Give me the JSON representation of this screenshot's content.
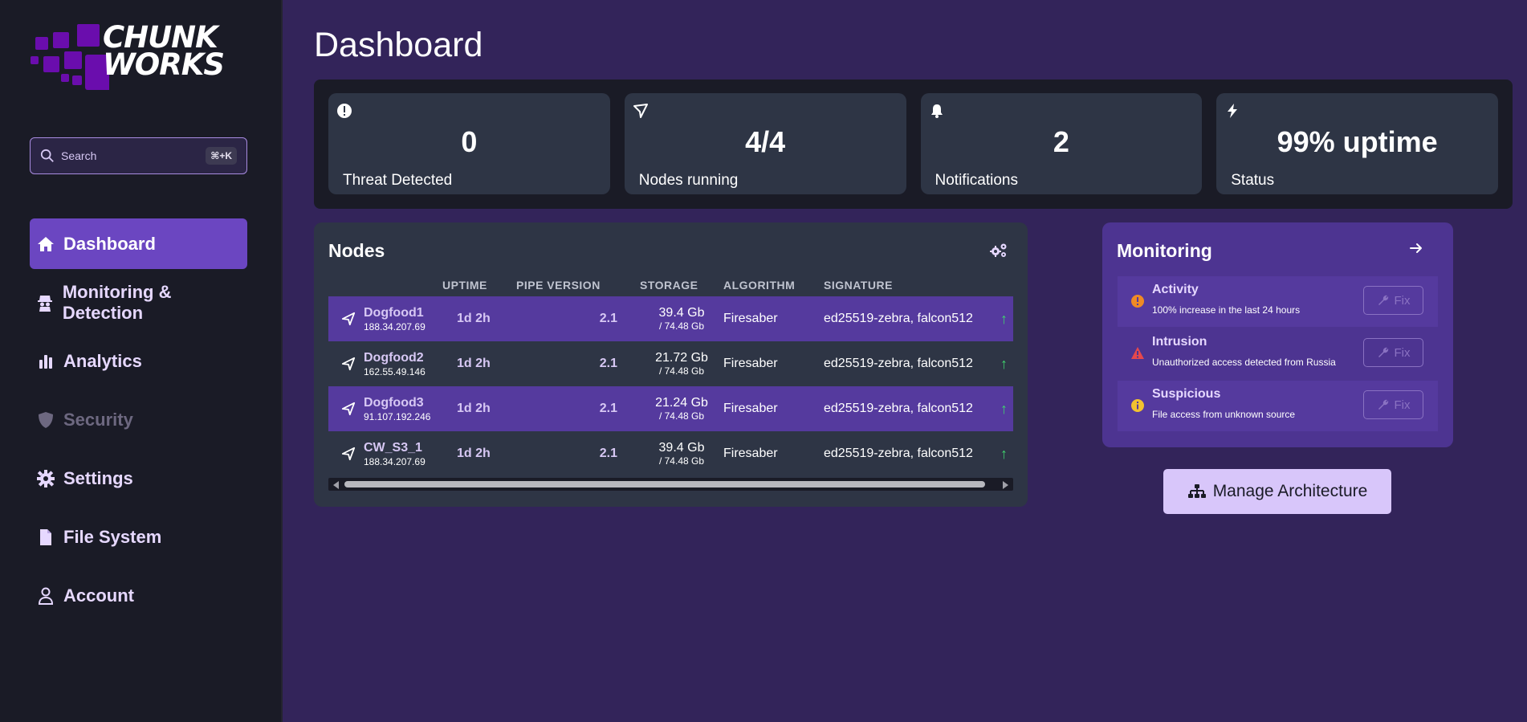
{
  "brand": {
    "line1": "CHUNK",
    "line2": "WORKS"
  },
  "search": {
    "placeholder": "Search",
    "shortcut": "⌘+K"
  },
  "nav": [
    {
      "label": "Dashboard",
      "icon": "home-icon",
      "active": true
    },
    {
      "label": "Monitoring & Detection",
      "icon": "detective-icon"
    },
    {
      "label": "Analytics",
      "icon": "bar-chart-icon"
    },
    {
      "label": "Security",
      "icon": "shield-icon",
      "disabled": true
    },
    {
      "label": "Settings",
      "icon": "gear-icon"
    },
    {
      "label": "File System",
      "icon": "file-icon"
    },
    {
      "label": "Account",
      "icon": "user-icon"
    }
  ],
  "page": {
    "title": "Dashboard"
  },
  "stats": [
    {
      "icon": "exclamation-icon",
      "value": "0",
      "label": "Threat Detected"
    },
    {
      "icon": "node-icon",
      "value": "4/4",
      "label": "Nodes running"
    },
    {
      "icon": "bell-icon",
      "value": "2",
      "label": "Notifications"
    },
    {
      "icon": "bolt-icon",
      "value": "99% uptime",
      "label": "Status"
    }
  ],
  "nodes": {
    "title": "Nodes",
    "columns": [
      "UPTIME",
      "PIPE VERSION",
      "STORAGE",
      "ALGORITHM",
      "SIGNATURE"
    ],
    "rows": [
      {
        "name": "Dogfood1",
        "ip": "188.34.207.69",
        "uptime": "1d 2h",
        "pipe": "2.1",
        "storage": "39.4 Gb",
        "capacity": "/ 74.48 Gb",
        "algorithm": "Firesaber",
        "signature": "ed25519-zebra, falcon512",
        "status": "↑"
      },
      {
        "name": "Dogfood2",
        "ip": "162.55.49.146",
        "uptime": "1d 2h",
        "pipe": "2.1",
        "storage": "21.72 Gb",
        "capacity": "/ 74.48 Gb",
        "algorithm": "Firesaber",
        "signature": "ed25519-zebra, falcon512",
        "status": "↑"
      },
      {
        "name": "Dogfood3",
        "ip": "91.107.192.246",
        "uptime": "1d 2h",
        "pipe": "2.1",
        "storage": "21.24 Gb",
        "capacity": "/ 74.48 Gb",
        "algorithm": "Firesaber",
        "signature": "ed25519-zebra, falcon512",
        "status": "↑"
      },
      {
        "name": "CW_S3_1",
        "ip": "188.34.207.69",
        "uptime": "1d 2h",
        "pipe": "2.1",
        "storage": "39.4 Gb",
        "capacity": "/ 74.48 Gb",
        "algorithm": "Firesaber",
        "signature": "ed25519-zebra, falcon512",
        "status": "↑"
      }
    ]
  },
  "monitoring": {
    "title": "Monitoring",
    "alerts": [
      {
        "title": "Activity",
        "desc": "100% increase in the last 24 hours",
        "level": "warning",
        "color": "#f08a24",
        "fix": "Fix"
      },
      {
        "title": "Intrusion",
        "desc": "Unauthorized access detected from Russia",
        "level": "danger",
        "color": "#e5484d",
        "fix": "Fix"
      },
      {
        "title": "Suspicious",
        "desc": "File access from unknown source",
        "level": "info",
        "color": "#f2c230",
        "fix": "Fix"
      }
    ]
  },
  "manage_button": {
    "label": "Manage Architecture"
  },
  "colors": {
    "accent": "#6b46c1",
    "sidebar": "#1a1b26",
    "background": "#33245a",
    "card": "#2e3545",
    "success": "#3fd36e"
  }
}
